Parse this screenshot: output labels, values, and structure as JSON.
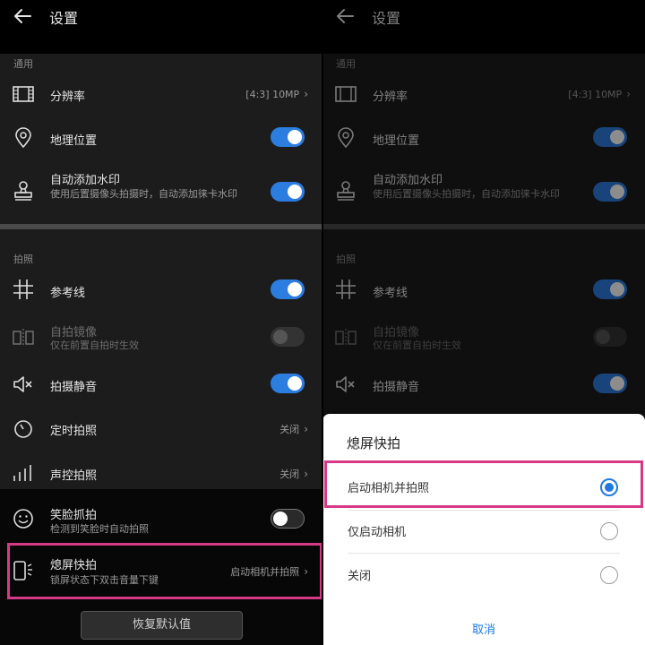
{
  "left": {
    "header": {
      "title": "设置"
    },
    "sections": {
      "general": "通用",
      "shooting": "拍照"
    },
    "rows": {
      "resolution": {
        "title": "分辨率",
        "value": "[4:3] 10MP"
      },
      "location": {
        "title": "地理位置",
        "toggle": "on"
      },
      "watermark": {
        "title": "自动添加水印",
        "sub": "使用后置摄像头拍摄时，自动添加徕卡水印",
        "toggle": "on"
      },
      "gridlines": {
        "title": "参考线",
        "toggle": "on"
      },
      "mirror": {
        "title": "自拍镜像",
        "sub": "仅在前置自拍时生效",
        "toggle": "off"
      },
      "mute": {
        "title": "拍摄静音",
        "toggle": "on"
      },
      "timer": {
        "title": "定时拍照",
        "value": "关闭"
      },
      "voice": {
        "title": "声控拍照",
        "value": "关闭"
      },
      "smile": {
        "title": "笑脸抓拍",
        "sub": "检测到笑脸时自动拍照",
        "toggle": "off"
      },
      "ultra_snapshot": {
        "title": "熄屏快拍",
        "sub": "锁屏状态下双击音量下键",
        "value": "启动相机并拍照"
      }
    },
    "restore_label": "恢复默认值"
  },
  "right": {
    "header": {
      "title": "设置"
    },
    "sections": {
      "general": "通用",
      "shooting": "拍照"
    },
    "rows": {
      "resolution": {
        "title": "分辨率",
        "value": "[4:3] 10MP"
      },
      "location": {
        "title": "地理位置"
      },
      "watermark": {
        "title": "自动添加水印",
        "sub": "使用后置摄像头拍摄时，自动添加徕卡水印"
      },
      "gridlines": {
        "title": "参考线"
      },
      "mirror": {
        "title": "自拍镜像",
        "sub": "仅在前置自拍时生效"
      },
      "mute": {
        "title": "拍摄静音"
      }
    },
    "dialog": {
      "title": "熄屏快拍",
      "options": [
        {
          "label": "启动相机并拍照",
          "selected": true
        },
        {
          "label": "仅启动相机",
          "selected": false
        },
        {
          "label": "关闭",
          "selected": false
        }
      ],
      "cancel": "取消"
    }
  },
  "colors": {
    "accent": "#2c7de0",
    "highlight": "#d63a86",
    "sheet_bg": "#ffffff"
  }
}
